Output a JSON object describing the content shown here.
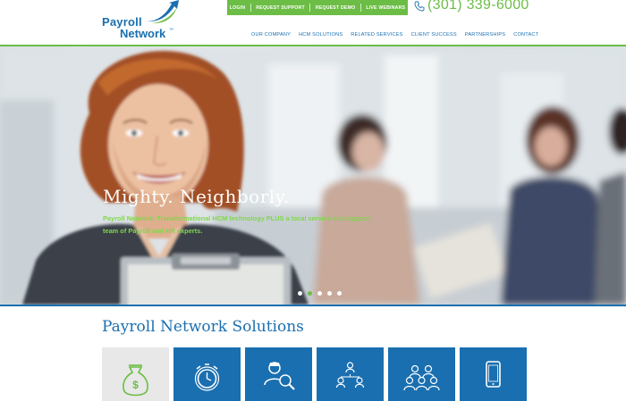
{
  "brand": {
    "word1": "Payroll",
    "word2": "Network",
    "tm": "™"
  },
  "topbar": {
    "items": [
      "LOGIN",
      "REQUEST SUPPORT",
      "REQUEST DEMO",
      "LIVE WEBINARS"
    ]
  },
  "phone": "(301) 339-6000",
  "nav": [
    "OUR COMPANY",
    "HCM SOLUTIONS",
    "RELATED SERVICES",
    "CLIENT SUCCESS",
    "PARTNERSHIPS",
    "CONTACT"
  ],
  "hero": {
    "headline": "Mighty. Neighborly.",
    "subtext": "Payroll Network: Transformational HCM technology PLUS a local service and support team of Payroll and HR experts.",
    "slides": 5,
    "active_slide": 2
  },
  "solutions": {
    "title": "Payroll Network Solutions",
    "tiles": [
      {
        "icon": "money-bag-icon",
        "style": "light"
      },
      {
        "icon": "stopwatch-icon",
        "style": "blue"
      },
      {
        "icon": "recruiter-search-icon",
        "style": "blue"
      },
      {
        "icon": "team-network-icon",
        "style": "blue"
      },
      {
        "icon": "people-group-icon",
        "style": "blue"
      },
      {
        "icon": "mobile-phone-icon",
        "style": "blue"
      }
    ]
  },
  "colors": {
    "brand_blue": "#1a6fb0",
    "brand_green": "#6cbd45"
  }
}
